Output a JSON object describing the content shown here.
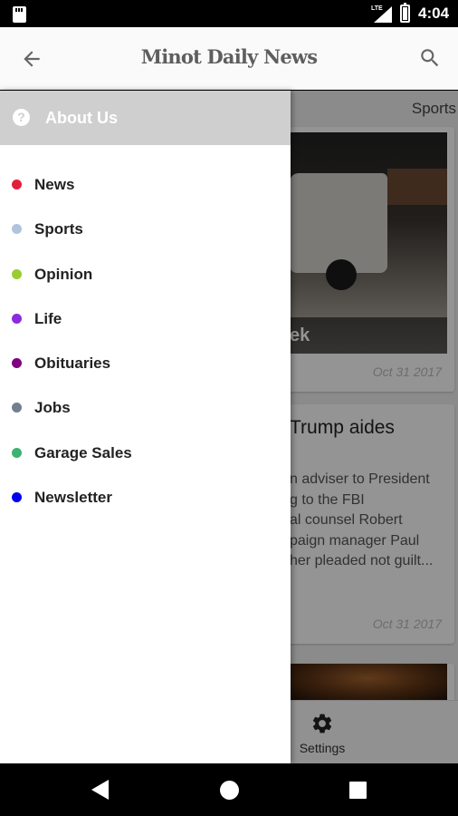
{
  "status_bar": {
    "network": "LTE",
    "time": "4:04"
  },
  "app_bar": {
    "title": "Minot Daily News"
  },
  "background_feed": {
    "section_label": "Sports",
    "card1": {
      "overlay_text": "ek",
      "date": "Oct 31 2017"
    },
    "card2": {
      "headline": "Trump aides",
      "excerpt_lines": [
        "n adviser to President",
        "g to the FBI",
        "al counsel Robert",
        "paign manager Paul",
        "her pleaded not guilt..."
      ],
      "date": "Oct 31 2017"
    },
    "bottom_nav": {
      "settings_label": "Settings"
    }
  },
  "drawer": {
    "header_label": "About Us",
    "items": [
      {
        "label": "News",
        "color": "#e0203a"
      },
      {
        "label": "Sports",
        "color": "#b0c4de"
      },
      {
        "label": "Opinion",
        "color": "#9acd32"
      },
      {
        "label": "Life",
        "color": "#8a2be2"
      },
      {
        "label": "Obituaries",
        "color": "#800080"
      },
      {
        "label": "Jobs",
        "color": "#708090"
      },
      {
        "label": "Garage Sales",
        "color": "#3cb371"
      },
      {
        "label": "Newsletter",
        "color": "#0000ee"
      }
    ]
  },
  "icons": {
    "back": "arrow-left-icon",
    "search": "search-icon",
    "help": "help-circle-icon",
    "settings": "gear-icon"
  }
}
